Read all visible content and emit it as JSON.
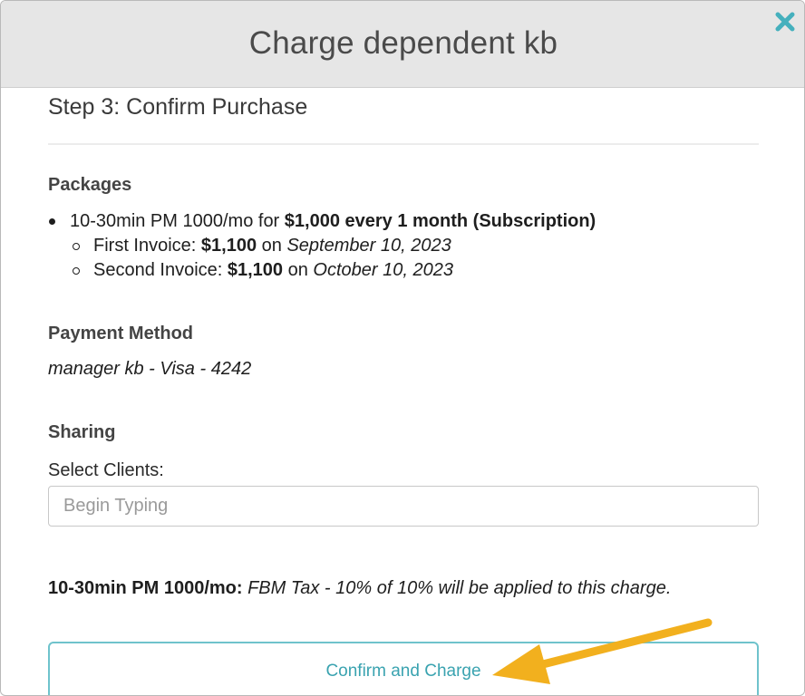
{
  "modal": {
    "title": "Charge dependent kb",
    "close_icon": "close-x-icon"
  },
  "step": {
    "title": "Step 3: Confirm Purchase"
  },
  "packages": {
    "heading": "Packages",
    "items": [
      {
        "name_prefix": "10-30min PM 1000/mo for ",
        "price_terms": "$1,000 every 1 month (Subscription)",
        "invoices": [
          {
            "label": "First Invoice: ",
            "amount": "$1,100",
            "connector": " on ",
            "date": "September 10, 2023"
          },
          {
            "label": "Second Invoice: ",
            "amount": "$1,100",
            "connector": " on ",
            "date": "October 10, 2023"
          }
        ]
      }
    ]
  },
  "payment": {
    "heading": "Payment Method",
    "method": "manager kb - Visa - 4242"
  },
  "sharing": {
    "heading": "Sharing",
    "select_label": "Select Clients:",
    "input_value": "",
    "input_placeholder": "Begin Typing"
  },
  "tax_note": {
    "package": "10-30min PM 1000/mo:",
    "description": "FBM Tax - 10% of 10% will be applied to this charge."
  },
  "actions": {
    "confirm_label": "Confirm and Charge"
  },
  "colors": {
    "header_bg": "#e6e6e6",
    "close_icon": "#45b0bd",
    "button_border": "#6fc3cc",
    "button_text": "#3aa3b0",
    "annotation_arrow": "#f2b01e"
  }
}
